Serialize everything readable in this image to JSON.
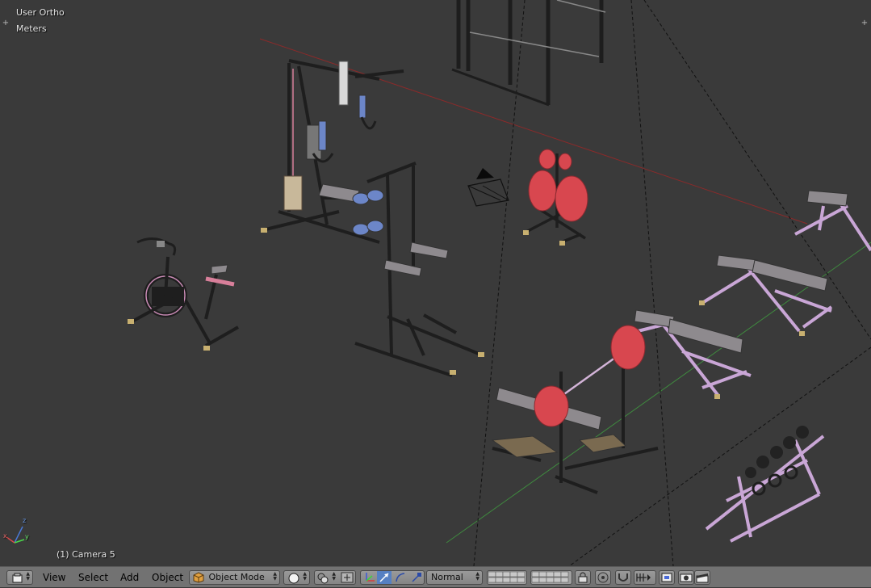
{
  "viewport": {
    "view_name": "User Ortho",
    "units": "Meters",
    "object_label": "(1) Camera 5",
    "axis_z": "z",
    "axis_y": "y",
    "axis_x": "x"
  },
  "header": {
    "menus": [
      "View",
      "Select",
      "Add",
      "Object"
    ],
    "mode": "Object Mode",
    "orientation": "Normal"
  },
  "colors": {
    "viewport_bg": "#3a3a3a",
    "header_bg": "#727272",
    "x_axis": "#8a2a2a",
    "y_axis": "#3f8a3f",
    "frame_metal": "#1e1e1e",
    "bench_purple": "#c9a6d6",
    "plate_red": "#d8474f",
    "pad_grey": "#8e8a8e",
    "cushion_blue": "#6c86c8"
  }
}
